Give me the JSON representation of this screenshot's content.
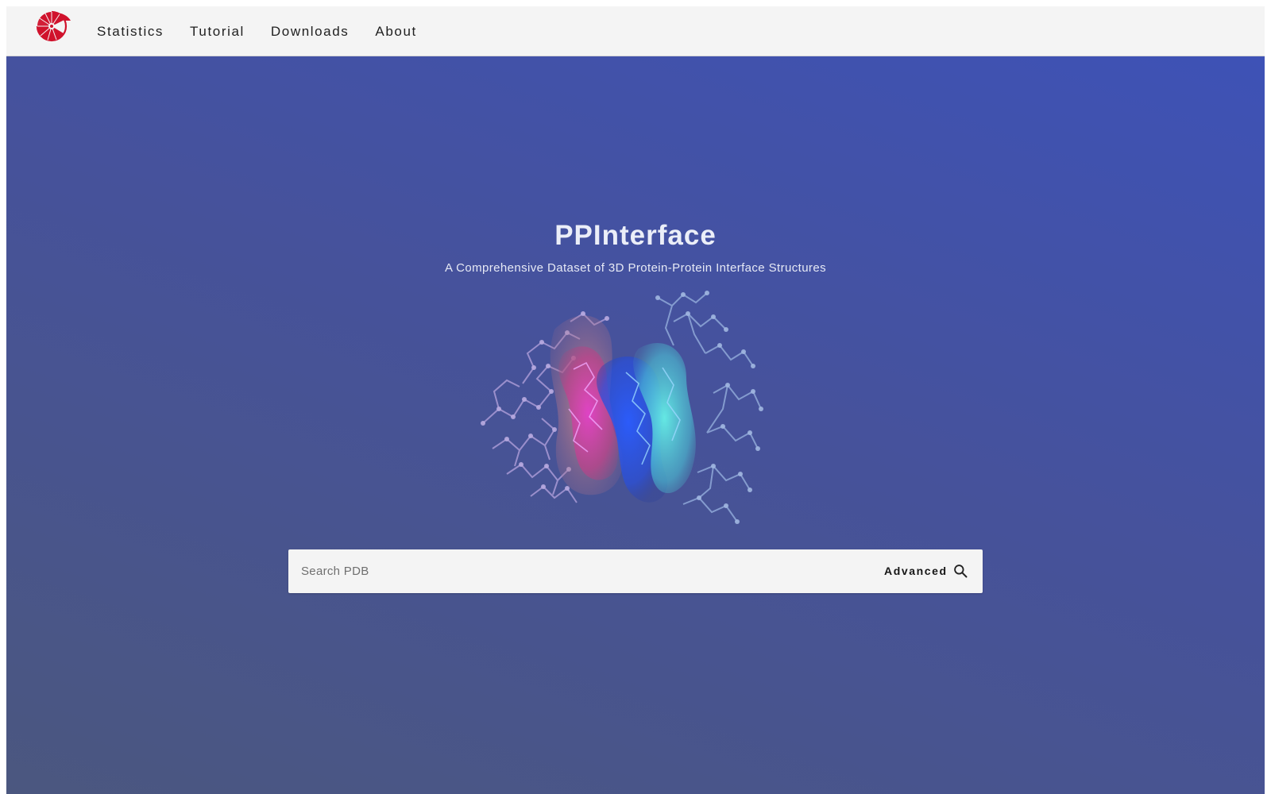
{
  "nav": {
    "logo_icon": "ammonite-logo-icon",
    "items": [
      {
        "label": "Statistics"
      },
      {
        "label": "Tutorial"
      },
      {
        "label": "Downloads"
      },
      {
        "label": "About"
      }
    ]
  },
  "hero": {
    "title": "PPInterface",
    "subtitle": "A Comprehensive Dataset of 3D Protein-Protein Interface Structures",
    "image_icon": "protein-structure-illustration"
  },
  "search": {
    "placeholder": "Search PDB",
    "value": "",
    "advanced_label": "Advanced",
    "icon": "search-icon"
  },
  "colors": {
    "nav_bg": "#f4f4f4",
    "hero_top": "#3e52b6",
    "hero_bottom": "#4b577f",
    "logo_red": "#d0122c",
    "title_text": "#ebeef8"
  }
}
